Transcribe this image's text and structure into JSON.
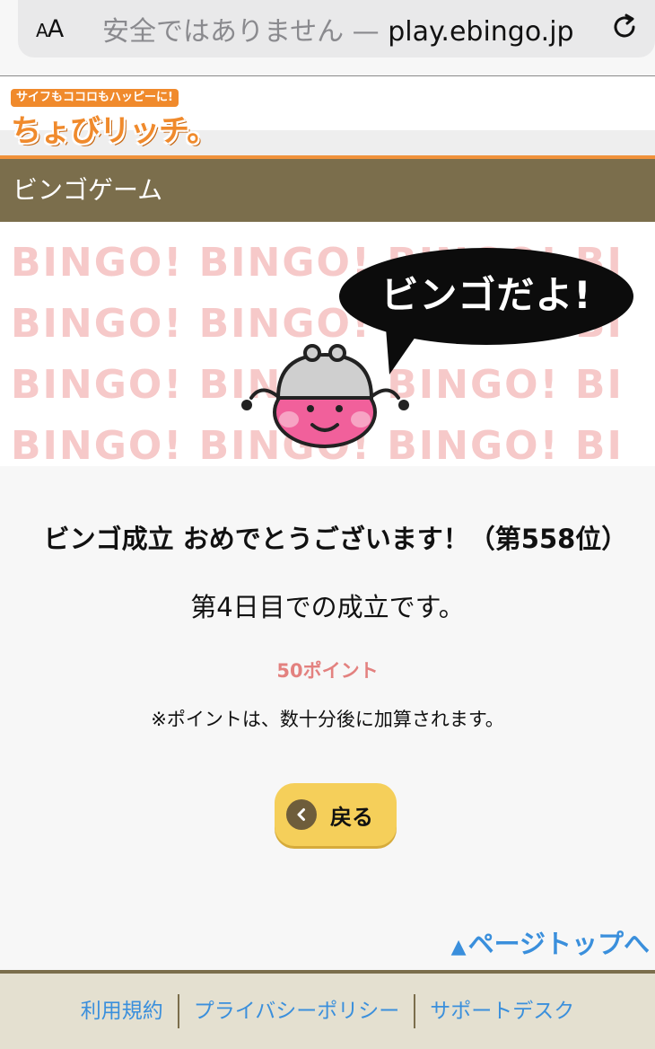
{
  "browser": {
    "aa_label": "AA",
    "insecure_label": "安全ではありません —",
    "host": "play.ebingo.jp",
    "reload_icon": "reload-icon"
  },
  "header": {
    "logo_tagline": "サイフもココロもハッピーに!",
    "logo_name": "ちょびリッチ。"
  },
  "page_title": "ビンゴゲーム",
  "banner": {
    "bingo_rows": [
      "BINGO! BINGO! BINGO! BI",
      "BINGO! BINGO! BINGO! BI",
      "BINGO! BINGO! BINGO! BI",
      "BINGO! BINGO! BINGO! BI"
    ],
    "speech_bubble": "ビンゴだよ!"
  },
  "result": {
    "congrats": "ビンゴ成立 おめでとうございます！（第558位）",
    "day_text": "第4日目での成立です。",
    "points": "50ポイント",
    "note": "※ポイントは、数十分後に加算されます。"
  },
  "back_button": {
    "label": "戻る",
    "icon": "chevron-left-icon"
  },
  "page_top": {
    "label": "ページトップへ",
    "icon": "triangle-up-icon"
  },
  "footer": {
    "links": [
      "利用規約",
      "プライバシーポリシー",
      "サポートデスク"
    ]
  },
  "colors": {
    "title_bar": "#7b6e4c",
    "accent_orange": "#f08a2c",
    "button_yellow": "#f5cf5a",
    "points_pink": "#e3817f",
    "link_blue": "#3a8fdc",
    "footer_bg": "#e4e0d0"
  }
}
